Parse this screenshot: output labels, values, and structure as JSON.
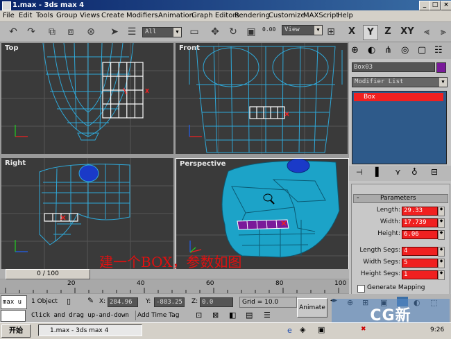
{
  "window": {
    "title": "1.max - 3ds max 4",
    "minimize": "_",
    "maximize": "□",
    "close": "×"
  },
  "menu": [
    "File",
    "Edit",
    "Tools",
    "Group",
    "Views",
    "Create",
    "Modifiers",
    "Animation",
    "Graph Editors",
    "Rendering",
    "Customize",
    "MAXScript",
    "Help"
  ],
  "toolbar": {
    "selection_filter": "All",
    "reference_coord": "View",
    "spinner_value": "0.00",
    "axes": [
      "X",
      "Y",
      "Z",
      "XY"
    ]
  },
  "viewports": [
    {
      "label": "Top"
    },
    {
      "label": "Front"
    },
    {
      "label": "Right"
    },
    {
      "label": "Perspective"
    }
  ],
  "annotation": "建一个BOX，参数如图",
  "command_panel": {
    "object_name": "Box03",
    "modifier_list": "Modifier List",
    "stack_item": "Box",
    "parameters_title": "Parameters",
    "params": [
      {
        "label": "Length:",
        "value": "29.33"
      },
      {
        "label": "Width:",
        "value": "17.739"
      },
      {
        "label": "Height:",
        "value": "6.06"
      },
      {
        "label": "Length Segs:",
        "value": "4"
      },
      {
        "label": "Width Segs:",
        "value": "5"
      },
      {
        "label": "Height Segs:",
        "value": "1"
      }
    ],
    "generate_mapping": "Generate Mapping",
    "collapse_sign": "-"
  },
  "timeline": {
    "frame_readout": "0 / 100",
    "ticks": [
      "20",
      "40",
      "60",
      "80",
      "100"
    ]
  },
  "status": {
    "script_label": "max u",
    "selection": "1 Object",
    "x_label": "X:",
    "x_value": "284.96",
    "y_label": "Y:",
    "y_value": "-883.25",
    "z_label": "Z:",
    "z_value": "0.0",
    "grid": "Grid = 10.0",
    "animate": "Animate",
    "prompt": "Click and drag up-and-down",
    "add_time_tag": "Add Time Tag"
  },
  "taskbar": {
    "start": "开始",
    "task": "1.max - 3ds max 4",
    "clock": "9:26",
    "watermark": "CG新"
  },
  "colors": {
    "wire": "#2fa8d8",
    "skull": "#1ca3c8",
    "box_white": "#ffffff",
    "selection_red": "#f02020",
    "box_purple": "#7a1a9a",
    "eye_blue": "#1a3ac8"
  }
}
